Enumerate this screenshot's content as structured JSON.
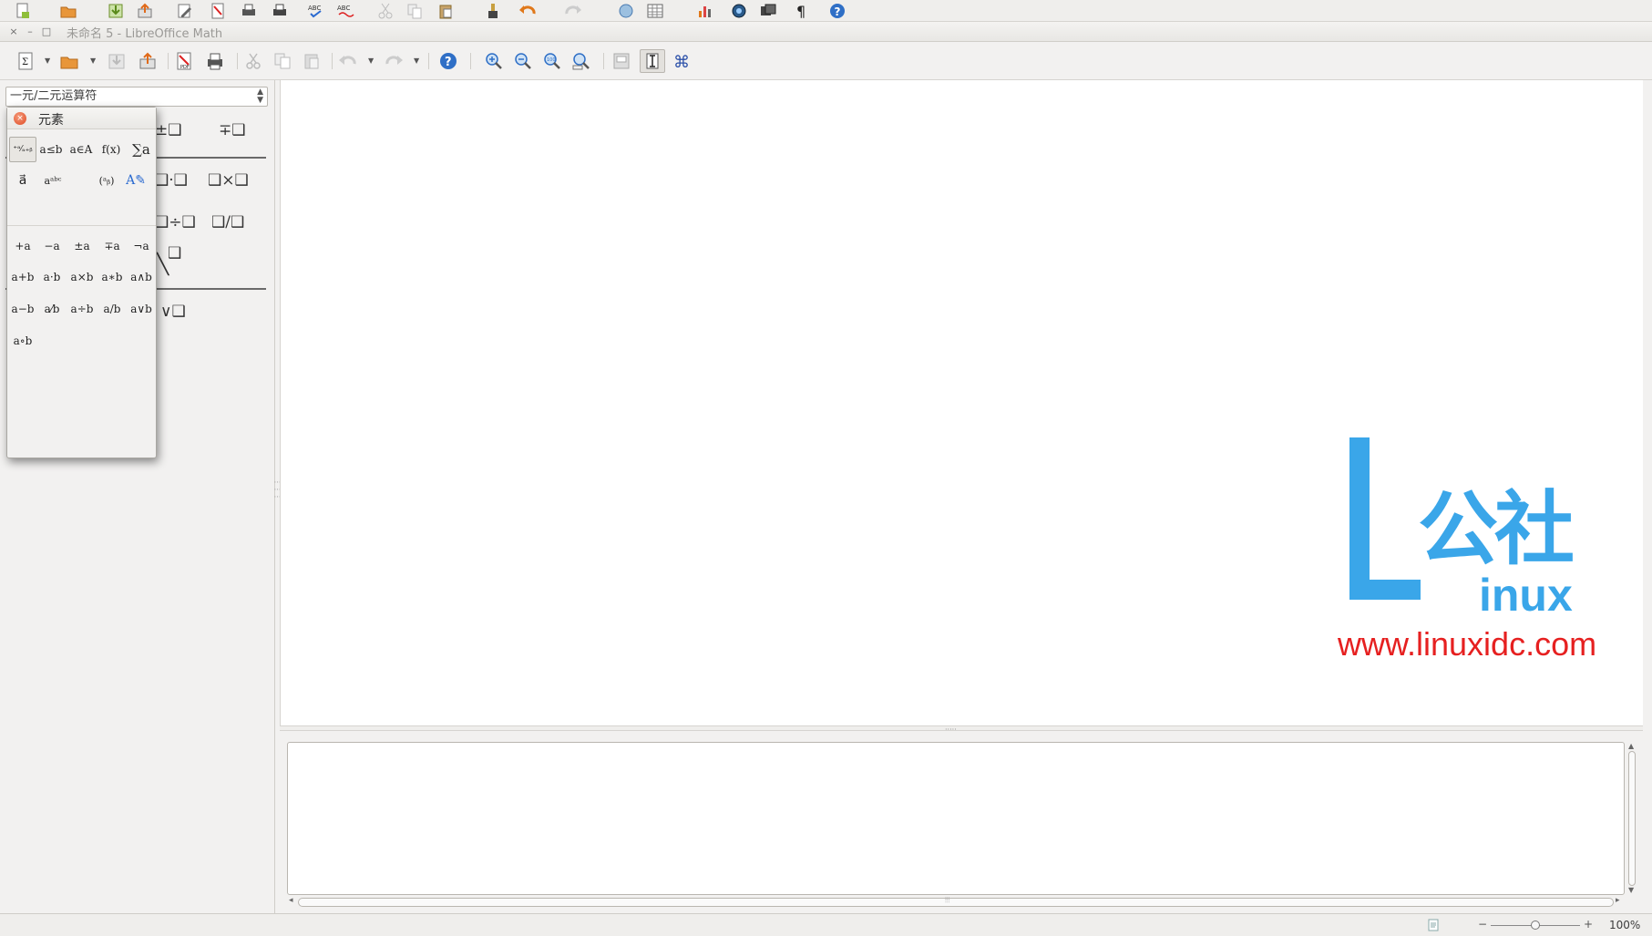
{
  "window": {
    "title": "未命名 5 - LibreOffice Math",
    "close_glyph": "×",
    "minimize_glyph": "–",
    "maximize_glyph": "□"
  },
  "toolbar": {
    "icons": [
      "new-formula-icon",
      "open-icon",
      "save-icon",
      "export-icon",
      "export-pdf-icon",
      "print-icon",
      "cut-icon",
      "copy-icon",
      "paste-icon",
      "undo-icon",
      "redo-icon",
      "help-icon",
      "zoom-in-icon",
      "zoom-out-icon",
      "zoom-100-icon",
      "show-all-icon",
      "update-icon",
      "formula-cursor-icon",
      "symbols-icon"
    ]
  },
  "left_panel": {
    "category_select": {
      "value": "一元/二元运算符"
    },
    "visible_operators": [
      {
        "label": "±❑"
      },
      {
        "label": "∓❑"
      },
      {
        "label": "❑·❑"
      },
      {
        "label": "❑×❑"
      },
      {
        "label": "❑÷❑"
      },
      {
        "label": "❑/❑"
      },
      {
        "label": "❑"
      },
      {
        "label": "╲"
      },
      {
        "label": "∨❑"
      }
    ]
  },
  "elements_dialog": {
    "title": "元素",
    "close_glyph": "×",
    "categories": [
      {
        "label": "⁺ᵃ⁄ₐ₊ᵦ",
        "active": true
      },
      {
        "label": "a≤b"
      },
      {
        "label": "a∈A"
      },
      {
        "label": "f(x)"
      },
      {
        "label": "∑a"
      },
      {
        "label": "a⃗"
      },
      {
        "label": "aᵃᵇᶜ"
      },
      {
        "label": "(ᵃᵦ)"
      },
      {
        "label": "A✎"
      }
    ],
    "items": [
      [
        "+a",
        "−a",
        "±a",
        "∓a",
        "¬a"
      ],
      [
        "a+b",
        "a·b",
        "a×b",
        "a∗b",
        "a∧b"
      ],
      [
        "a−b",
        "a⁄b",
        "a÷b",
        "a/b",
        "a∨b"
      ],
      [
        "a∘b"
      ]
    ]
  },
  "statusbar": {
    "zoom_minus": "−",
    "zoom_plus": "+",
    "zoom_level": "100%",
    "zoom_fraction": 0.5
  },
  "watermark": {
    "cn_text": "公社",
    "inux_text": "inux",
    "url": "www.linuxidc.com",
    "color_blue": "#3aa6e9",
    "color_red": "#e62020"
  }
}
